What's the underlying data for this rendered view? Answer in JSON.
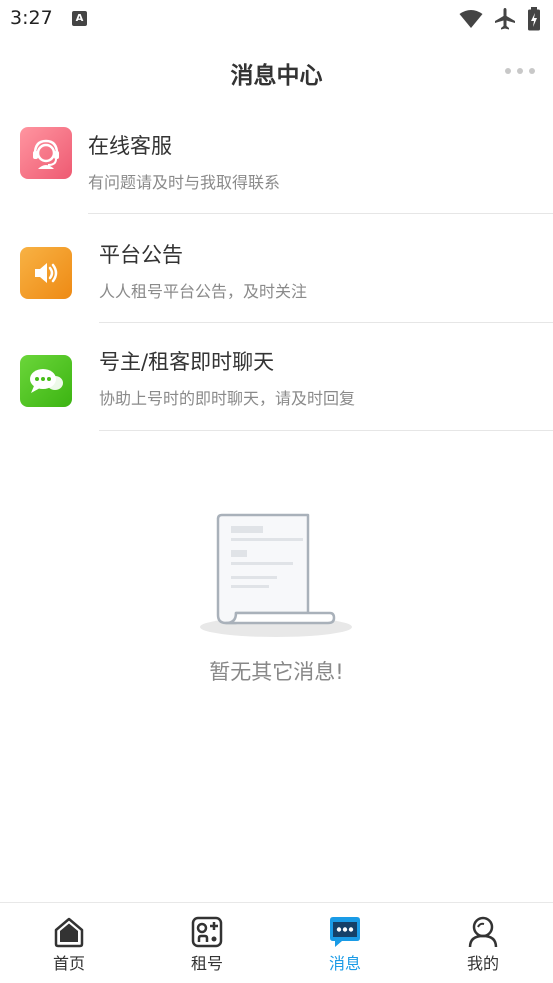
{
  "status": {
    "time": "3:27",
    "notif_letter": "A"
  },
  "header": {
    "title": "消息中心"
  },
  "messages": [
    {
      "title": "在线客服",
      "subtitle": "有问题请及时与我取得联系",
      "icon": "customer-service-headset-icon",
      "color": "#f06a7e"
    },
    {
      "title": "平台公告",
      "subtitle": "人人租号平台公告，及时关注",
      "icon": "speaker-icon",
      "color": "#f29a24"
    },
    {
      "title": "号主/租客即时聊天",
      "subtitle": "协助上号时的即时聊天，请及时回复",
      "icon": "chat-bubble-icon",
      "color": "#4cc21b"
    }
  ],
  "empty": {
    "text": "暂无其它消息!"
  },
  "tabbar": {
    "active_color": "#1a9be6",
    "tabs": [
      {
        "label": "首页",
        "icon": "home-icon"
      },
      {
        "label": "租号",
        "icon": "gamepad-icon"
      },
      {
        "label": "消息",
        "icon": "message-icon",
        "active": true
      },
      {
        "label": "我的",
        "icon": "profile-icon"
      }
    ]
  }
}
